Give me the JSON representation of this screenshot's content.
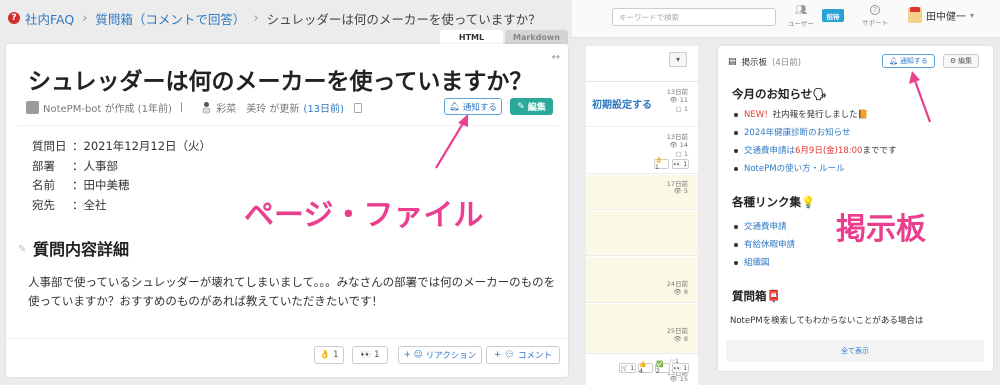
{
  "breadcrumb": {
    "root": "社内FAQ",
    "folder": "質問箱（コメントで回答）",
    "current": "シュレッダーは何のメーカーを使っていますか？"
  },
  "tabs": {
    "html": "HTML",
    "markdown": "Markdown"
  },
  "page": {
    "title": "シュレッダーは何のメーカーを使っていますか？",
    "meta": {
      "creator": "NotePM-bot が作成 (1年前)",
      "separator": "|",
      "updater": "彩菜　美玲 が更新",
      "updated": "(13日前)"
    },
    "notify_label": "通知する",
    "edit_label": "編集",
    "info": [
      {
        "key": "質問日",
        "sep": "：",
        "value": "2021年12月12日（火）"
      },
      {
        "key": "部署",
        "sep": "：",
        "value": "人事部"
      },
      {
        "key": "名前",
        "sep": "：",
        "value": "田中美穂"
      },
      {
        "key": "宛先",
        "sep": "：",
        "value": "全社"
      }
    ],
    "section_heading": "質問内容詳細",
    "body_line1": "人事部で使っているシュレッダーが壊れてしまいまして。。。みなさんの部署では何のメーカーのものを",
    "body_line2": "使っていますか？おすすめのものがあれば教えていただきたいです！",
    "reactions": [
      {
        "emoji": "👌",
        "count": "1"
      },
      {
        "emoji": "👀",
        "count": "1"
      }
    ],
    "reaction_label": "リアクション",
    "comment_label": "コメント",
    "overlay_label": "ページ・ファイル"
  },
  "topbar": {
    "search_placeholder": "キーワードで検索",
    "users_label": "ユーザー",
    "invite_label": "招待",
    "support_label": "サポート",
    "user_name": "田中健一"
  },
  "middle": {
    "visible_title": "初期設定する",
    "rows": [
      {
        "date": "13日前",
        "views": "11",
        "comments": "1"
      },
      {
        "date": "13日前",
        "views": "14",
        "comments": "1"
      },
      {
        "date": "17日前",
        "views": "5"
      },
      {
        "date": "24日前",
        "views": "8"
      },
      {
        "date": "25日前",
        "views": "8"
      },
      {
        "date": "13日前",
        "views": "15",
        "stars": "1"
      }
    ],
    "chips_row2": [
      "👌 1",
      "👀 1"
    ],
    "chips_last": [
      "🛒 1",
      "👍 4",
      "✅ 2",
      "👀 1"
    ]
  },
  "board": {
    "title": "掲示板",
    "days": "(4日前)",
    "notify_label": "通知する",
    "edit_label": "編集",
    "news_heading": "今月のお知らせ🗣",
    "news": [
      {
        "prefix": "NEW！",
        "text": "社内報を発行しました📙"
      },
      {
        "text": "2024年健康診断のお知らせ"
      },
      {
        "text_a": "交通費申請は",
        "text_red": "6月9日(金)18:00",
        "text_b": "までです"
      },
      {
        "text": "NotePMの使い方・ルール"
      }
    ],
    "links_heading": "各種リンク集💡",
    "links": [
      "交通費申請",
      "有給休暇申請",
      "組織図"
    ],
    "qbox_heading": "質問箱📮",
    "qbox_text": "NotePMを検索してもわからないことがある場合は",
    "show_all": "全て表示",
    "overlay_label": "掲示板"
  },
  "colors": {
    "accent_pink": "#ea3f8e",
    "link_blue": "#2f78c4",
    "edit_green": "#2aa89a"
  }
}
